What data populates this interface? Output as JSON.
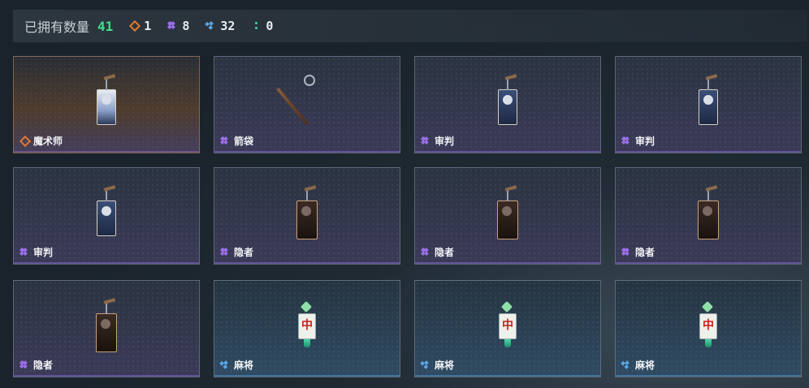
{
  "summary": {
    "owned_label": "已拥有数量",
    "owned_count": "41",
    "stats": [
      {
        "icon": "orange-rarity-icon",
        "value": "1"
      },
      {
        "icon": "purple-rarity-icon",
        "value": "8"
      },
      {
        "icon": "blue-rarity-icon",
        "value": "32"
      },
      {
        "icon": "green-rarity-icon",
        "value": "0"
      }
    ]
  },
  "items": [
    {
      "name": "魔术师",
      "rarity": "orange",
      "art": "tarot-light"
    },
    {
      "name": "箭袋",
      "rarity": "purple",
      "art": "staff"
    },
    {
      "name": "审判",
      "rarity": "purple",
      "art": "tarot"
    },
    {
      "name": "审判",
      "rarity": "purple",
      "art": "tarot"
    },
    {
      "name": "审判",
      "rarity": "purple",
      "art": "tarot"
    },
    {
      "name": "隐者",
      "rarity": "purple",
      "art": "tarot-dark"
    },
    {
      "name": "隐者",
      "rarity": "purple",
      "art": "tarot-dark"
    },
    {
      "name": "隐者",
      "rarity": "purple",
      "art": "tarot-dark"
    },
    {
      "name": "隐者",
      "rarity": "purple",
      "art": "tarot-dark"
    },
    {
      "name": "麻将",
      "rarity": "blue",
      "art": "mahjong"
    },
    {
      "name": "麻将",
      "rarity": "blue",
      "art": "mahjong"
    },
    {
      "name": "麻将",
      "rarity": "blue",
      "art": "mahjong"
    }
  ],
  "mahjong_char": "中",
  "colors": {
    "orange": "#e0782f",
    "purple": "#9a6ee8",
    "blue": "#5aa6e6",
    "green": "#3fd6a0",
    "count": "#40e08a"
  }
}
